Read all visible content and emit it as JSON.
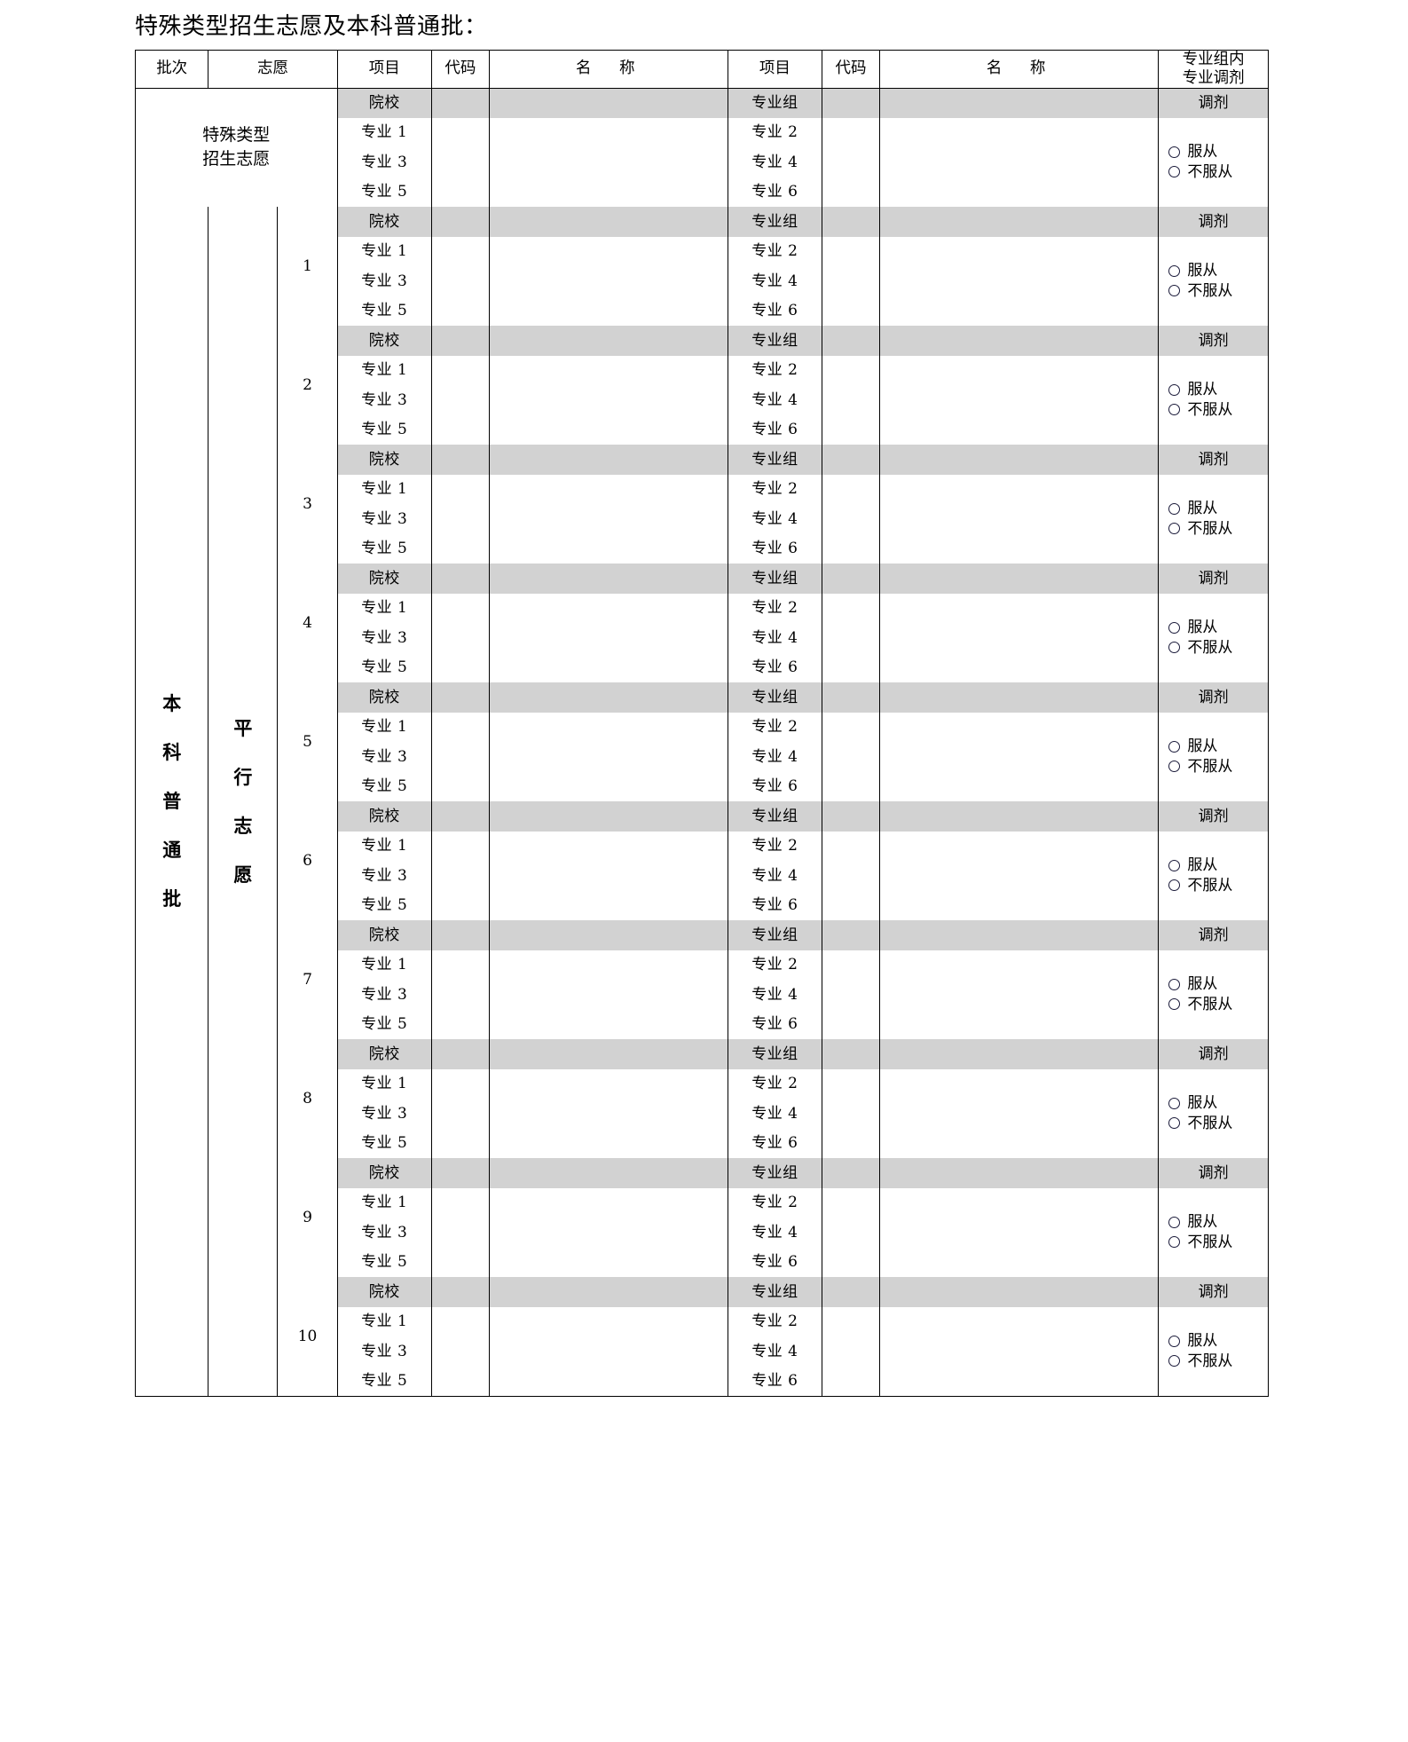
{
  "document": {
    "title": "特殊类型招生志愿及本科普通批："
  },
  "table": {
    "headers": {
      "batch": "批次",
      "wish": "志愿",
      "item1": "项目",
      "code1": "代码",
      "name1": "名　称",
      "item2": "项目",
      "code2": "代码",
      "name2": "名　称",
      "adjust_line1": "专业组内",
      "adjust_line2": "专业调剂"
    },
    "labels": {
      "school": "院校",
      "major_group": "专业组",
      "major1": "专业 1",
      "major2": "专业 2",
      "major3": "专业 3",
      "major4": "专业 4",
      "major5": "专业 5",
      "major6": "专业 6",
      "adjust": "调剂",
      "obey": "服从",
      "not_obey": "不服从"
    },
    "special_block": {
      "label_line1": "特殊类型",
      "label_line2": "招生志愿"
    },
    "undergrad_block": {
      "batch_label": "本科普通批",
      "wish_label": "平行志愿",
      "wish_numbers": [
        "1",
        "2",
        "3",
        "4",
        "5",
        "6",
        "7",
        "8",
        "9",
        "10"
      ]
    },
    "colors": {
      "shade": "#d2d2d2",
      "border": "#000000",
      "radio_outline": "#1b1b3a"
    }
  }
}
